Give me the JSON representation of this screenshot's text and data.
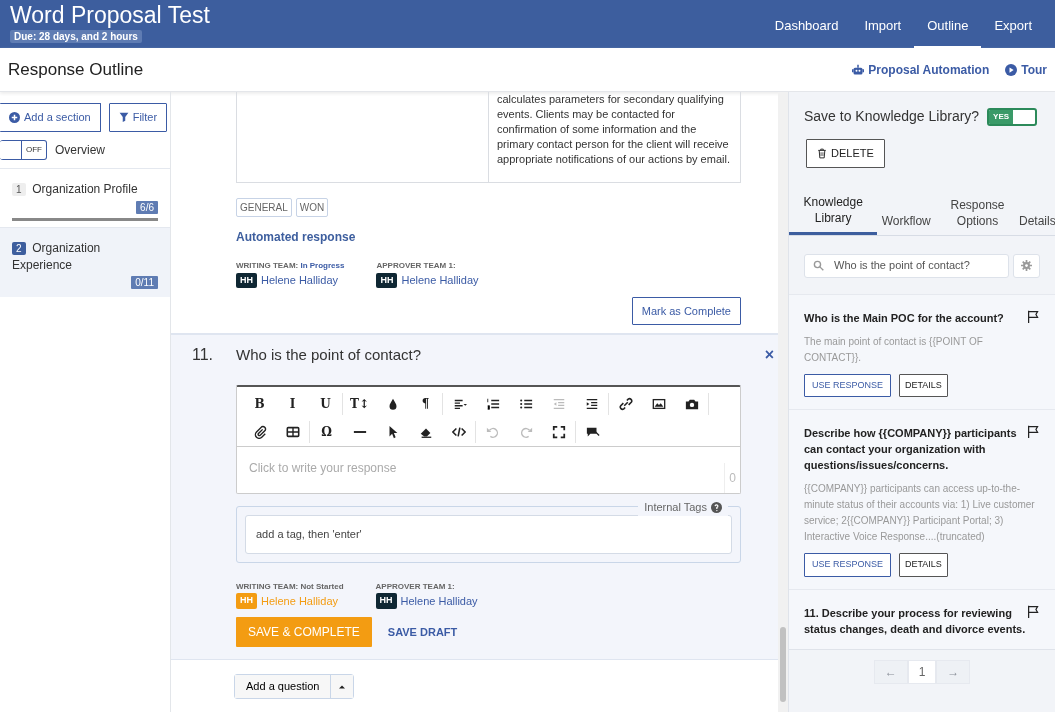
{
  "header": {
    "title": "Word Proposal Test",
    "due": "Due: 28 days, and 2 hours",
    "nav": [
      {
        "label": "Dashboard",
        "selected": false
      },
      {
        "label": "Import",
        "selected": false
      },
      {
        "label": "Outline",
        "selected": true
      },
      {
        "label": "Export",
        "selected": false
      }
    ]
  },
  "subheader": {
    "title": "Response Outline",
    "automation": "Proposal Automation",
    "tour": "Tour"
  },
  "sidebar": {
    "add_section": "Add a section",
    "filter": "Filter",
    "overview_toggle": {
      "label": "OFF",
      "on": false
    },
    "overview": "Overview",
    "items": [
      {
        "number": "1",
        "name": "Organization Profile",
        "count": "6/6",
        "level": 1,
        "selected": false
      },
      {
        "number": "2",
        "name": "Organization Experience",
        "count": "0/11",
        "selected": true
      }
    ]
  },
  "previous_question": {
    "answer": "calculates parameters for secondary qualifying events. Clients may be contacted for confirmation of some information and the primary contact person for the client will receive appropriate notifications of our actions by email.",
    "tags": [
      "GENERAL",
      "WON"
    ],
    "source": "Automated response",
    "writing_team": {
      "label": "WRITING TEAM:",
      "status": "In Progress",
      "initials": "HH",
      "name": "Helene Halliday",
      "started": true
    },
    "approver_team": {
      "label": "APPROVER TEAM 1:",
      "initials": "HH",
      "name": "Helene Halliday"
    },
    "mark_complete": "Mark as Complete"
  },
  "question": {
    "number": "11.",
    "title": "Who is the point of contact?",
    "close": "×",
    "toolbar": [
      [
        {
          "kind": "text",
          "label": "B",
          "disabled": false
        },
        {
          "kind": "text",
          "label": "I",
          "disabled": false
        },
        {
          "kind": "text",
          "label": "U",
          "disabled": false
        }
      ],
      [
        {
          "kind": "text",
          "label": "T↕",
          "disabled": false
        },
        {
          "kind": "drop",
          "disabled": false
        },
        {
          "kind": "text",
          "label": "¶",
          "disabled": false
        }
      ],
      [
        {
          "kind": "align",
          "disabled": false
        },
        {
          "kind": "ol",
          "disabled": false
        },
        {
          "kind": "ul",
          "disabled": false
        },
        {
          "kind": "outdent",
          "disabled": true
        },
        {
          "kind": "indent",
          "disabled": false
        }
      ],
      [
        {
          "kind": "link",
          "disabled": false
        },
        {
          "kind": "image",
          "disabled": false
        },
        {
          "kind": "camera",
          "disabled": false
        }
      ],
      [
        {
          "kind": "clip",
          "disabled": false
        },
        {
          "kind": "table",
          "disabled": false
        }
      ],
      [
        {
          "kind": "text",
          "label": "Ω",
          "disabled": false
        },
        {
          "kind": "rule",
          "disabled": false
        },
        {
          "kind": "pointer",
          "disabled": false
        },
        {
          "kind": "eraser",
          "disabled": false
        },
        {
          "kind": "code",
          "disabled": false
        }
      ],
      [
        {
          "kind": "undo",
          "disabled": true
        },
        {
          "kind": "redo",
          "disabled": true
        },
        {
          "kind": "fullscreen",
          "disabled": false
        }
      ],
      [
        {
          "kind": "comment",
          "disabled": false
        }
      ]
    ],
    "placeholder": "Click to write your response",
    "char_count": "0",
    "tags_legend": "Internal Tags",
    "tags_placeholder": "add a tag, then 'enter'",
    "writing_team": {
      "label": "WRITING TEAM: Not Started",
      "initials": "HH",
      "name": "Helene Halliday",
      "started": false
    },
    "approver_team": {
      "label": "APPROVER TEAM 1:",
      "initials": "HH",
      "name": "Helene Halliday"
    },
    "save_complete": "SAVE & COMPLETE",
    "save_draft": "SAVE DRAFT"
  },
  "add_question": "Add a question",
  "panel": {
    "save_label": "Save to Knowledge Library?",
    "save_toggle": {
      "label": "YES",
      "on": true
    },
    "delete": "DELETE",
    "tabs": [
      {
        "label": "Knowledge Library",
        "selected": true
      },
      {
        "label": "Workflow",
        "selected": false
      },
      {
        "label": "Response Options",
        "selected": false
      },
      {
        "label": "Details",
        "selected": false
      }
    ],
    "search": {
      "value": "Who is the point of contact?"
    },
    "results": [
      {
        "title": "Who is the Main POC for the account?",
        "body": "The main point of contact is {{POINT OF CONTACT}}.",
        "use": "USE RESPONSE",
        "details": "DETAILS"
      },
      {
        "title": "Describe how {{COMPANY}} participants can contact your organization with questions/issues/concerns.",
        "body": "{{COMPANY}} participants can access up-to-the-minute status of their accounts via: 1) Live customer service; 2{{COMPANY}} Participant Portal; 3) Interactive Voice Response....(truncated)",
        "use": "USE RESPONSE",
        "details": "DETAILS"
      },
      {
        "title": "11. Describe your process for reviewing status changes, death and divorce events."
      }
    ],
    "pagination": {
      "prev": "←",
      "page": "1",
      "next": "→"
    }
  }
}
